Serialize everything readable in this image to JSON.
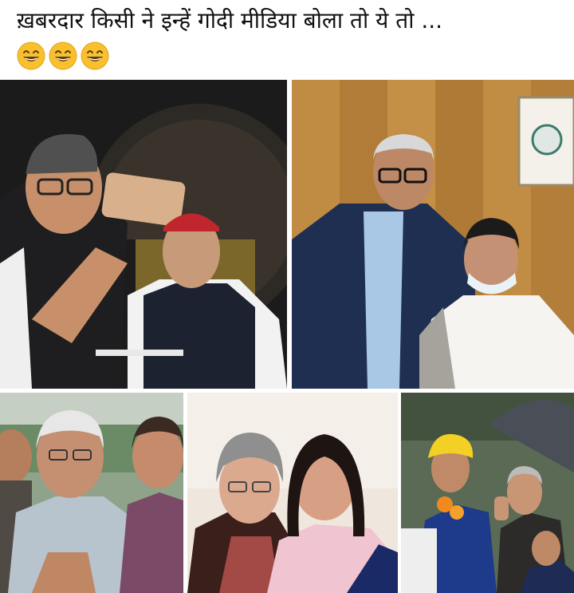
{
  "post": {
    "caption": "ख़बरदार किसी ने इन्हें गोदी मीडिया बोला तो ये तो ...",
    "emojis": [
      "grinning-smiling-eyes-emoji",
      "grinning-smiling-eyes-emoji",
      "grinning-smiling-eyes-emoji"
    ]
  },
  "collage": {
    "photo_count": 5,
    "photos": [
      {
        "id": "selfie-photo"
      },
      {
        "id": "wood-panel-photo"
      },
      {
        "id": "outdoor-crowd-photo"
      },
      {
        "id": "two-women-photo"
      },
      {
        "id": "rally-crowd-photo"
      }
    ]
  },
  "colors": {
    "background": "#ffffff",
    "text": "#111111",
    "emoji_yellow": "#f9c02e"
  }
}
